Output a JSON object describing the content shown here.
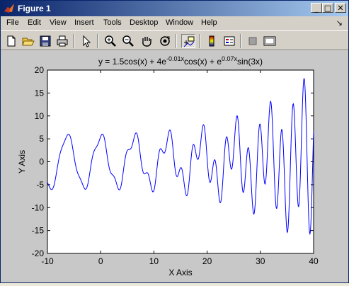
{
  "window": {
    "title": "Figure 1",
    "controls": {
      "minimize": "_",
      "maximize": "□",
      "close": "✕"
    }
  },
  "menubar": {
    "items": [
      {
        "label": "File"
      },
      {
        "label": "Edit"
      },
      {
        "label": "View"
      },
      {
        "label": "Insert"
      },
      {
        "label": "Tools"
      },
      {
        "label": "Desktop"
      },
      {
        "label": "Window"
      },
      {
        "label": "Help"
      }
    ],
    "dock_arrow": "↘"
  },
  "toolbar": {
    "icons": [
      "new-file-icon",
      "open-folder-icon",
      "save-icon",
      "print-icon",
      "select-arrow-icon",
      "zoom-in-icon",
      "zoom-out-icon",
      "pan-hand-icon",
      "rotate-3d-icon",
      "data-cursor-icon",
      "colorbar-icon",
      "legend-icon",
      "hide-plot-tools-icon",
      "show-plot-tools-icon"
    ]
  },
  "chart_data": {
    "type": "line",
    "title_parts": {
      "t1": "y = 1.5cos(x) + 4e",
      "s1": "-0.01x",
      "t2": "cos(x) + e",
      "s2": "0.07x",
      "t3": "sin(3x)"
    },
    "xlabel": "X Axis",
    "ylabel": "Y Axis",
    "xlim": [
      -10,
      40
    ],
    "ylim": [
      -20,
      20
    ],
    "xticks": [
      -10,
      0,
      10,
      20,
      30,
      40
    ],
    "yticks": [
      -20,
      -15,
      -10,
      -5,
      0,
      5,
      10,
      15,
      20
    ],
    "grid": false,
    "series": [
      {
        "color": "#0000FF",
        "function": "1.5*cos(x) + 4*exp(-0.01*x)*cos(x) + exp(0.07*x)*sin(3*x)",
        "x_range": [
          -10,
          40
        ],
        "samples": 800
      }
    ]
  },
  "colors": {
    "titlebar_start": "#0A246A",
    "titlebar_end": "#A6CAF0",
    "chrome": "#D4D0C8",
    "figure_bg": "#C8C8C8",
    "axes_bg": "#FFFFFF",
    "line": "#0000FF"
  }
}
